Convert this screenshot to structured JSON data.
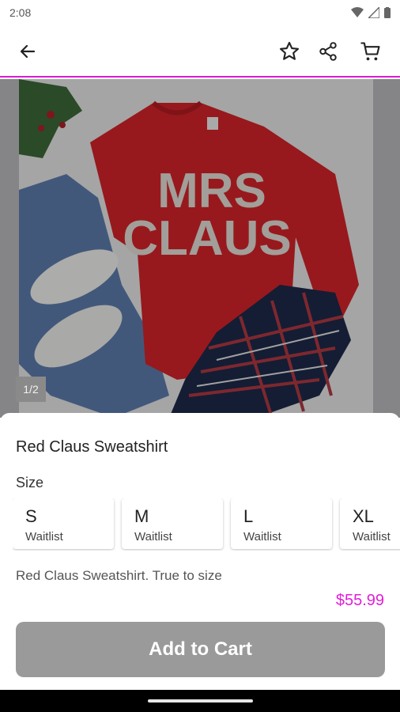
{
  "status_bar": {
    "time": "2:08"
  },
  "product": {
    "image_counter": "1/2",
    "shirt_text_line1": "MRS",
    "shirt_text_line2": "CLAUS",
    "title": "Red Claus Sweatshirt",
    "size_label": "Size",
    "sizes": [
      {
        "name": "S",
        "status": "Waitlist"
      },
      {
        "name": "M",
        "status": "Waitlist"
      },
      {
        "name": "L",
        "status": "Waitlist"
      },
      {
        "name": "XL",
        "status": "Waitlist"
      }
    ],
    "description": "Red Claus Sweatshirt. True to size",
    "price": "$55.99",
    "add_to_cart_label": "Add to Cart"
  },
  "colors": {
    "accent": "#d61fd1",
    "price": "#e01fd8",
    "button": "#9a9a9a"
  },
  "icons": [
    "back-arrow-icon",
    "star-icon",
    "share-icon",
    "cart-icon",
    "wifi-icon",
    "signal-icon",
    "battery-icon"
  ]
}
